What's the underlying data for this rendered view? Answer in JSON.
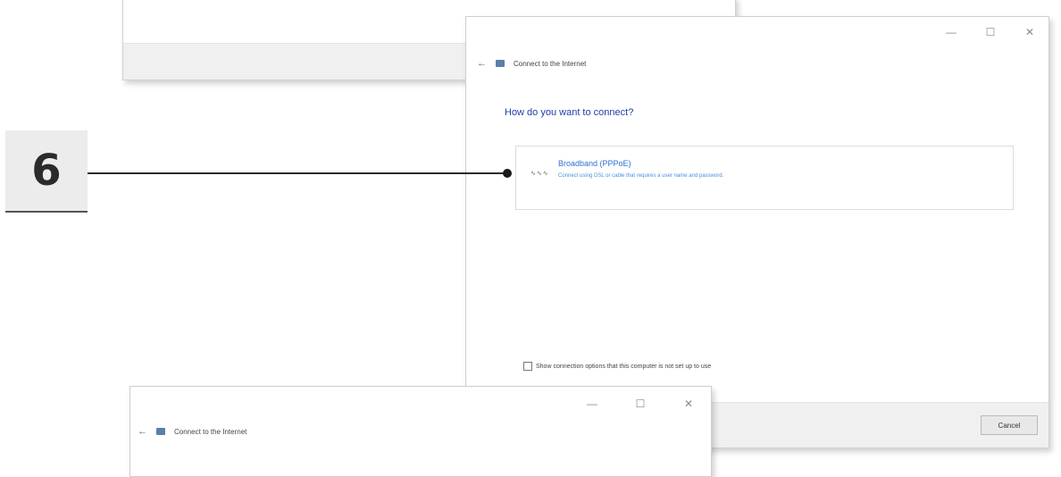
{
  "windows": {
    "main": {
      "title": "Connect to the Internet",
      "question": "How do you want to connect?",
      "option": {
        "icon_text": "∿∿∿",
        "title": "Broadband (PPPoE)",
        "description": "Connect using DSL or cable that requires a user name and password."
      },
      "show_options_label": "Show connection options that this computer is not set up to use",
      "cancel_label": "Cancel",
      "controls": {
        "minimize": "—",
        "maximize": "☐",
        "close": "✕"
      }
    },
    "bottom": {
      "title": "Connect to the Internet",
      "controls": {
        "minimize": "—",
        "maximize": "☐",
        "close": "✕"
      }
    }
  },
  "annotation": {
    "step_number": "6"
  },
  "icons": {
    "back": "←"
  }
}
